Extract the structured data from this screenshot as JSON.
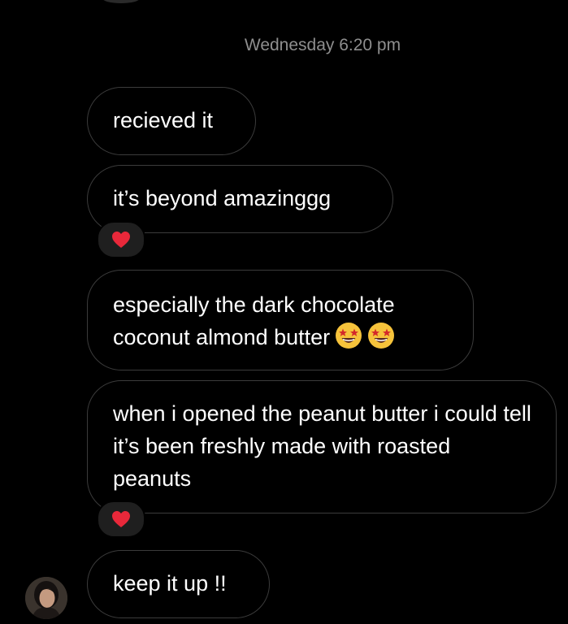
{
  "thread": {
    "timestamp": "Wednesday 6:20 pm",
    "messages": [
      {
        "text": "recieved it"
      },
      {
        "text": "it’s beyond amazinggg",
        "reaction": "red-heart"
      },
      {
        "text": "especially the dark chocolate coconut almond butter",
        "emoji": [
          "star-struck",
          "star-struck"
        ]
      },
      {
        "text": "when i opened the peanut butter i could tell it’s been freshly made with roasted peanuts",
        "reaction": "red-heart"
      },
      {
        "text": "keep it up !!"
      }
    ]
  },
  "colors": {
    "background": "#000000",
    "bubble_border": "#3b3b3b",
    "timestamp": "#8e8e8e",
    "reaction_pill": "#1f1f1f",
    "heart": "#e8283a"
  }
}
